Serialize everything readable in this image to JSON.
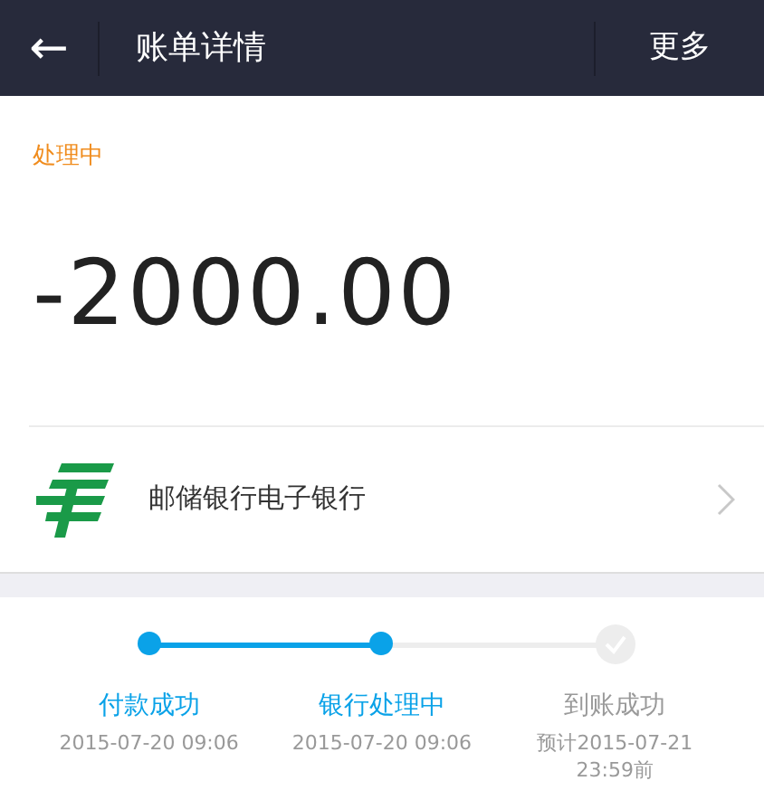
{
  "header": {
    "back_icon": "←",
    "title": "账单详情",
    "menu": "更多"
  },
  "status": "处理中",
  "amount": "-2000.00",
  "bank": {
    "name": "邮储银行电子银行"
  },
  "steps": [
    {
      "label": "付款成功",
      "time": "2015-07-20 09:06",
      "done": true
    },
    {
      "label": "银行处理中",
      "time": "2015-07-20 09:06",
      "done": true
    },
    {
      "label": "到账成功",
      "time": "预计2015-07-21 23:59前",
      "done": false
    }
  ]
}
